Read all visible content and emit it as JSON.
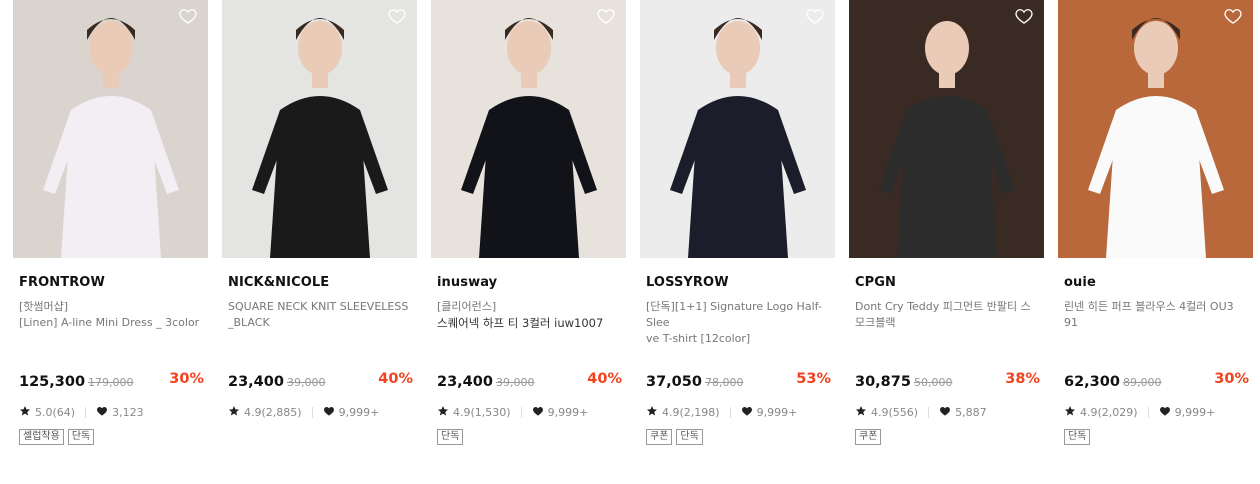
{
  "products": [
    {
      "brand": "FRONTROW",
      "desc1": "[핫썸머샵]",
      "desc2": "[Linen] A-line Mini Dress _ 3color",
      "price": "125,300",
      "original": "179,000",
      "discount": "30%",
      "rating": "5.0(64)",
      "likes": "3,123",
      "tags": [
        "셀럽착용",
        "단독"
      ],
      "bg": "#d9d4ce",
      "fg": "#f2eef4"
    },
    {
      "brand": "NICK&NICOLE",
      "desc1": "SQUARE NECK KNIT SLEEVELESS",
      "desc2": "_BLACK",
      "price": "23,400",
      "original": "39,000",
      "discount": "40%",
      "rating": "4.9(2,885)",
      "likes": "9,999+",
      "tags": [],
      "bg": "#e4e4e2",
      "fg": "#1a1a1a"
    },
    {
      "brand": "inusway",
      "desc1": "[클리어런스]",
      "desc2": "스퀘어넥 하프 티 3컬러 iuw1007",
      "price": "23,400",
      "original": "39,000",
      "discount": "40%",
      "rating": "4.9(1,530)",
      "likes": "9,999+",
      "tags": [
        "단독"
      ],
      "bg": "#e8e2dc",
      "fg": "#111318"
    },
    {
      "brand": "LOSSYROW",
      "desc1": "[단독][1+1] Signature Logo Half-Slee",
      "desc2": "ve T-shirt [12color]",
      "price": "37,050",
      "original": "78,000",
      "discount": "53%",
      "rating": "4.9(2,198)",
      "likes": "9,999+",
      "tags": [
        "쿠폰",
        "단독"
      ],
      "bg": "#ececec",
      "fg": "#1b1d2a"
    },
    {
      "brand": "CPGN",
      "desc1": "Dont Cry Teddy 피그먼트 반팔티 스",
      "desc2": "모크블랙",
      "price": "30,875",
      "original": "50,000",
      "discount": "38%",
      "rating": "4.9(556)",
      "likes": "5,887",
      "tags": [
        "쿠폰"
      ],
      "bg": "#3a2a24",
      "fg": "#2c2c2c"
    },
    {
      "brand": "ouie",
      "desc1": "린넨 히든 퍼프 블라우스 4컬러 OU3",
      "desc2": "91",
      "price": "62,300",
      "original": "89,000",
      "discount": "30%",
      "rating": "4.9(2,029)",
      "likes": "9,999+",
      "tags": [
        "단독"
      ],
      "bg": "#b8683a",
      "fg": "#fafafa"
    }
  ]
}
